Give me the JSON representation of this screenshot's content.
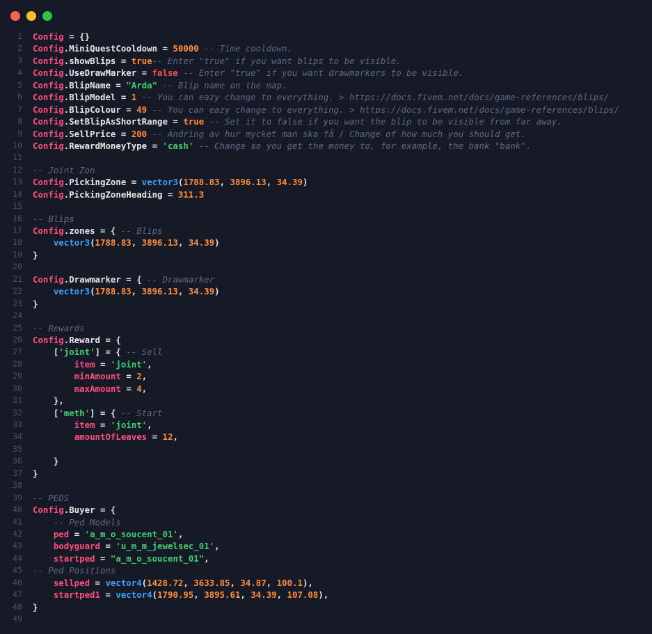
{
  "window": {
    "buttons": [
      "close",
      "minimize",
      "maximize"
    ]
  },
  "colors": {
    "background": "#151a26",
    "keyword": "#ff4f7e",
    "number": "#ff8f3d",
    "string": "#3ecf72",
    "comment": "#5d6885",
    "function": "#3aa0ff",
    "false": "#ff4f4f"
  },
  "lines": [
    [
      [
        "k",
        "Config"
      ],
      [
        "p",
        " = {}"
      ]
    ],
    [
      [
        "k",
        "Config"
      ],
      [
        "p",
        ".MiniQuestCooldown = "
      ],
      [
        "n",
        "50000"
      ],
      [
        "c",
        " -- Time cooldown."
      ]
    ],
    [
      [
        "k",
        "Config"
      ],
      [
        "p",
        ".showBlips = "
      ],
      [
        "b",
        "true"
      ],
      [
        "c",
        "-- Enter \"true\" if you want blips to be visible."
      ]
    ],
    [
      [
        "k",
        "Config"
      ],
      [
        "p",
        ".UseDrawMarker = "
      ],
      [
        "f",
        "false"
      ],
      [
        "c",
        " -- Enter \"true\" if you want drawmarkers to be visible."
      ]
    ],
    [
      [
        "k",
        "Config"
      ],
      [
        "p",
        ".BlipName = "
      ],
      [
        "s",
        "\"Arda\""
      ],
      [
        "c",
        " -- Blip name on the map."
      ]
    ],
    [
      [
        "k",
        "Config"
      ],
      [
        "p",
        ".BlipModel = "
      ],
      [
        "n",
        "1"
      ],
      [
        "c",
        " -- You can eazy change to everything. > https://docs.fivem.net/docs/game-references/blips/"
      ]
    ],
    [
      [
        "k",
        "Config"
      ],
      [
        "p",
        ".BlipColour = "
      ],
      [
        "n",
        "49"
      ],
      [
        "c",
        " -- You can eazy change to everything. > https://docs.fivem.net/docs/game-references/blips/"
      ]
    ],
    [
      [
        "k",
        "Config"
      ],
      [
        "p",
        ".SetBlipAsShortRange = "
      ],
      [
        "b",
        "true"
      ],
      [
        "c",
        " -- Set it to false if you want the blip to be visible from far away."
      ]
    ],
    [
      [
        "k",
        "Config"
      ],
      [
        "p",
        ".SellPrice = "
      ],
      [
        "n",
        "200"
      ],
      [
        "c",
        " -- Ändring av hur mycket man ska få / Change of how much you should get."
      ]
    ],
    [
      [
        "k",
        "Config"
      ],
      [
        "p",
        ".RewardMoneyType = "
      ],
      [
        "s",
        "'cash'"
      ],
      [
        "c",
        " -- Change so you get the money to, for example, the bank \"bank\"."
      ]
    ],
    [],
    [
      [
        "c",
        "-- Joint Zon"
      ]
    ],
    [
      [
        "k",
        "Config"
      ],
      [
        "p",
        ".PickingZone = "
      ],
      [
        "fn",
        "vector3"
      ],
      [
        "p",
        "("
      ],
      [
        "n",
        "1788.83"
      ],
      [
        "p",
        ", "
      ],
      [
        "n",
        "3896.13"
      ],
      [
        "p",
        ", "
      ],
      [
        "n",
        "34.39"
      ],
      [
        "p",
        ")"
      ]
    ],
    [
      [
        "k",
        "Config"
      ],
      [
        "p",
        ".PickingZoneHeading = "
      ],
      [
        "n",
        "311.3"
      ]
    ],
    [],
    [
      [
        "c",
        "-- Blips"
      ]
    ],
    [
      [
        "k",
        "Config"
      ],
      [
        "p",
        ".zones = { "
      ],
      [
        "c",
        "-- Blips"
      ]
    ],
    [
      [
        "p",
        "    "
      ],
      [
        "fn",
        "vector3"
      ],
      [
        "p",
        "("
      ],
      [
        "n",
        "1788.83"
      ],
      [
        "p",
        ", "
      ],
      [
        "n",
        "3896.13"
      ],
      [
        "p",
        ", "
      ],
      [
        "n",
        "34.39"
      ],
      [
        "p",
        ")"
      ]
    ],
    [
      [
        "p",
        "}"
      ]
    ],
    [],
    [
      [
        "k",
        "Config"
      ],
      [
        "p",
        ".Drawmarker = { "
      ],
      [
        "c",
        "-- Drawmarker"
      ]
    ],
    [
      [
        "p",
        "    "
      ],
      [
        "fn",
        "vector3"
      ],
      [
        "p",
        "("
      ],
      [
        "n",
        "1788.83"
      ],
      [
        "p",
        ", "
      ],
      [
        "n",
        "3896.13"
      ],
      [
        "p",
        ", "
      ],
      [
        "n",
        "34.39"
      ],
      [
        "p",
        ")"
      ]
    ],
    [
      [
        "p",
        "}"
      ]
    ],
    [],
    [
      [
        "c",
        "-- Rewards"
      ]
    ],
    [
      [
        "k",
        "Config"
      ],
      [
        "p",
        ".Reward = {"
      ]
    ],
    [
      [
        "p",
        "    ["
      ],
      [
        "s",
        "'joint'"
      ],
      [
        "p",
        "] = { "
      ],
      [
        "c",
        "-- Sell"
      ]
    ],
    [
      [
        "p",
        "        "
      ],
      [
        "k",
        "item"
      ],
      [
        "p",
        " = "
      ],
      [
        "s",
        "'joint'"
      ],
      [
        "p",
        ","
      ]
    ],
    [
      [
        "p",
        "        "
      ],
      [
        "k",
        "minAmount"
      ],
      [
        "p",
        " = "
      ],
      [
        "n",
        "2"
      ],
      [
        "p",
        ","
      ]
    ],
    [
      [
        "p",
        "        "
      ],
      [
        "k",
        "maxAmount"
      ],
      [
        "p",
        " = "
      ],
      [
        "n",
        "4"
      ],
      [
        "p",
        ","
      ]
    ],
    [
      [
        "p",
        "    },"
      ]
    ],
    [
      [
        "p",
        "    ["
      ],
      [
        "s",
        "'meth'"
      ],
      [
        "p",
        "] = { "
      ],
      [
        "c",
        "-- Start"
      ]
    ],
    [
      [
        "p",
        "        "
      ],
      [
        "k",
        "item"
      ],
      [
        "p",
        " = "
      ],
      [
        "s",
        "'joint'"
      ],
      [
        "p",
        ","
      ]
    ],
    [
      [
        "p",
        "        "
      ],
      [
        "k",
        "amountOfLeaves"
      ],
      [
        "p",
        " = "
      ],
      [
        "n",
        "12"
      ],
      [
        "p",
        ","
      ]
    ],
    [],
    [
      [
        "p",
        "    }"
      ]
    ],
    [
      [
        "p",
        "}"
      ]
    ],
    [],
    [
      [
        "c",
        "-- PEDS"
      ]
    ],
    [
      [
        "k",
        "Config"
      ],
      [
        "p",
        ".Buyer = {"
      ]
    ],
    [
      [
        "p",
        "    "
      ],
      [
        "c",
        "-- Ped Models"
      ]
    ],
    [
      [
        "p",
        "    "
      ],
      [
        "k",
        "ped"
      ],
      [
        "p",
        " = "
      ],
      [
        "s",
        "'a_m_o_soucent_01'"
      ],
      [
        "p",
        ","
      ]
    ],
    [
      [
        "p",
        "    "
      ],
      [
        "k",
        "bodyguard"
      ],
      [
        "p",
        " = "
      ],
      [
        "s",
        "'u_m_m_jewelsec_01'"
      ],
      [
        "p",
        ","
      ]
    ],
    [
      [
        "p",
        "    "
      ],
      [
        "k",
        "startped"
      ],
      [
        "p",
        " = "
      ],
      [
        "s",
        "\"a_m_o_soucent_01\""
      ],
      [
        "p",
        ","
      ]
    ],
    [
      [
        "c",
        "-- Ped Positions"
      ]
    ],
    [
      [
        "p",
        "    "
      ],
      [
        "k",
        "sellped"
      ],
      [
        "p",
        " = "
      ],
      [
        "fn",
        "vector4"
      ],
      [
        "p",
        "("
      ],
      [
        "n",
        "1428.72"
      ],
      [
        "p",
        ", "
      ],
      [
        "n",
        "3633.85"
      ],
      [
        "p",
        ", "
      ],
      [
        "n",
        "34.87"
      ],
      [
        "p",
        ", "
      ],
      [
        "n",
        "100.1"
      ],
      [
        "p",
        "),"
      ]
    ],
    [
      [
        "p",
        "    "
      ],
      [
        "k",
        "startped1"
      ],
      [
        "p",
        " = "
      ],
      [
        "fn",
        "vector4"
      ],
      [
        "p",
        "("
      ],
      [
        "n",
        "1790.95"
      ],
      [
        "p",
        ", "
      ],
      [
        "n",
        "3895.61"
      ],
      [
        "p",
        ", "
      ],
      [
        "n",
        "34.39"
      ],
      [
        "p",
        ", "
      ],
      [
        "n",
        "107.08"
      ],
      [
        "p",
        "),"
      ]
    ],
    [
      [
        "p",
        "}"
      ]
    ],
    []
  ]
}
